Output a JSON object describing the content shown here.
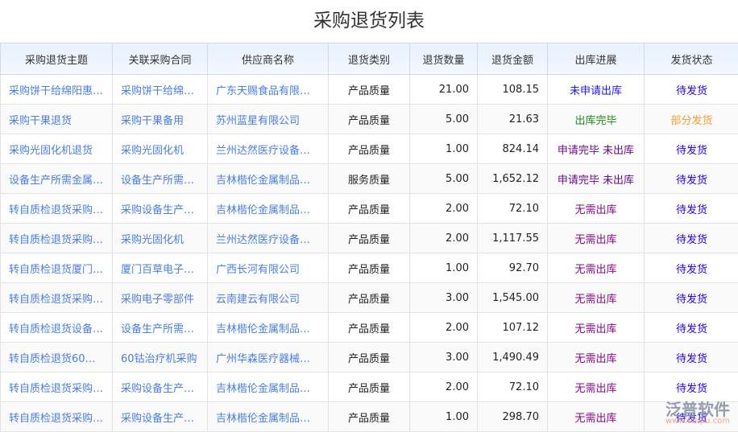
{
  "title": "采购退货列表",
  "columns": [
    "采购退货主题",
    "关联采购合同",
    "供应商名称",
    "退货类别",
    "退货数量",
    "退货金额",
    "出库进展",
    "发货状态"
  ],
  "colors": {
    "link": "#4a7ee0",
    "pending_ship": "#2200ee",
    "partial_ship": "#f0a030",
    "not_applied": "#1a1aee",
    "done": "#1a8a1a",
    "applied": "#6a0a8a",
    "no_need": "#8a0a8a"
  },
  "rows": [
    [
      "采购饼干给绵阳惠…",
      "采购饼干给绵…",
      "广东天赐食品有限…",
      "产品质量",
      "21.00",
      "108.15",
      "未申请出库",
      "待发货"
    ],
    [
      "采购干果退货",
      "采购干果备用",
      "苏州蓝星有限公司",
      "产品质量",
      "5.00",
      "21.63",
      "出库完毕",
      "部分发货"
    ],
    [
      "采购光固化机退货",
      "采购光固化机",
      "兰州达然医疗设备…",
      "产品质量",
      "1.00",
      "824.14",
      "申请完毕 未出库",
      "待发货"
    ],
    [
      "设备生产所需金属…",
      "设备生产所需…",
      "吉林楷伦金属制品…",
      "服务质量",
      "5.00",
      "1,652.12",
      "申请完毕 未出库",
      "待发货"
    ],
    [
      "转自质检退货采购…",
      "采购设备生产…",
      "吉林楷伦金属制品…",
      "产品质量",
      "2.00",
      "72.10",
      "无需出库",
      "待发货"
    ],
    [
      "转自质检退货采购…",
      "采购光固化机",
      "兰州达然医疗设备…",
      "产品质量",
      "2.00",
      "1,117.55",
      "无需出库",
      "待发货"
    ],
    [
      "转自质检退货厦门…",
      "厦门百草电子…",
      "广西长河有限公司",
      "产品质量",
      "1.00",
      "92.70",
      "无需出库",
      "待发货"
    ],
    [
      "转自质检退货采购…",
      "采购电子零部件",
      "云南建云有限公司",
      "产品质量",
      "3.00",
      "1,545.00",
      "无需出库",
      "待发货"
    ],
    [
      "转自质检退货设备…",
      "设备生产所需…",
      "吉林楷伦金属制品…",
      "产品质量",
      "2.00",
      "107.12",
      "无需出库",
      "待发货"
    ],
    [
      "转自质检退货60…",
      "60钴治疗机采购",
      "广州华森医疗器械…",
      "产品质量",
      "3.00",
      "1,490.49",
      "无需出库",
      "待发货"
    ],
    [
      "转自质检退货采购…",
      "采购设备生产…",
      "吉林楷伦金属制品…",
      "产品质量",
      "2.00",
      "72.10",
      "无需出库",
      "待发货"
    ],
    [
      "转自质检退货采购…",
      "采购设备生产…",
      "吉林楷伦金属制品…",
      "产品质量",
      "1.00",
      "298.70",
      "无需出库",
      "待发货"
    ]
  ],
  "watermark": {
    "name": "泛普软件",
    "url": "www.fanpu.com"
  }
}
